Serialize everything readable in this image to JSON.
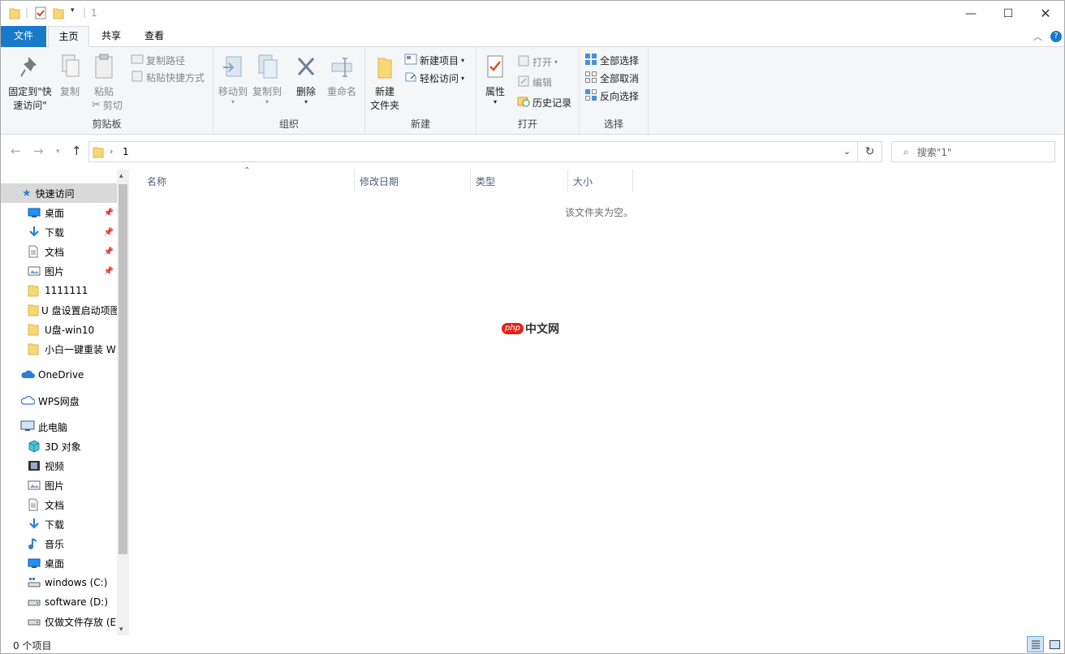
{
  "window": {
    "title": "1"
  },
  "tabs": {
    "file": "文件",
    "home": "主页",
    "share": "共享",
    "view": "查看"
  },
  "ribbon": {
    "clipboard": {
      "label": "剪贴板",
      "pin": "固定到\"快\n速访问\"",
      "copy": "复制",
      "paste": "粘贴",
      "copy_path": "复制路径",
      "paste_shortcut": "粘贴快捷方式",
      "cut": "剪切"
    },
    "organize": {
      "label": "组织",
      "move_to": "移动到",
      "copy_to": "复制到",
      "delete": "删除",
      "rename": "重命名"
    },
    "new": {
      "label": "新建",
      "new_folder": "新建\n文件夹",
      "new_item": "新建项目",
      "easy_access": "轻松访问"
    },
    "open": {
      "label": "打开",
      "properties": "属性",
      "open": "打开",
      "edit": "编辑",
      "history": "历史记录"
    },
    "select": {
      "label": "选择",
      "select_all": "全部选择",
      "select_none": "全部取消",
      "invert": "反向选择"
    }
  },
  "address": {
    "crumb": "1",
    "search_placeholder": "搜索\"1\""
  },
  "nav": {
    "quick_access": "快速访问",
    "quick_items": [
      {
        "label": "桌面",
        "icon": "desktop-icon",
        "pinned": true
      },
      {
        "label": "下载",
        "icon": "download-icon",
        "pinned": true
      },
      {
        "label": "文档",
        "icon": "document-icon",
        "pinned": true
      },
      {
        "label": "图片",
        "icon": "picture-icon",
        "pinned": true
      },
      {
        "label": "1111111",
        "icon": "folder-icon",
        "pinned": false
      },
      {
        "label": "U 盘设置启动项图",
        "icon": "folder-icon",
        "pinned": false
      },
      {
        "label": "U盘-win10",
        "icon": "folder-icon",
        "pinned": false
      },
      {
        "label": "小白一键重装 W",
        "icon": "folder-icon",
        "pinned": false
      }
    ],
    "onedrive": "OneDrive",
    "wps": "WPS网盘",
    "this_pc": "此电脑",
    "pc_items": [
      {
        "label": "3D 对象",
        "icon": "3d-objects-icon"
      },
      {
        "label": "视频",
        "icon": "video-icon"
      },
      {
        "label": "图片",
        "icon": "picture-icon"
      },
      {
        "label": "文档",
        "icon": "document-icon"
      },
      {
        "label": "下载",
        "icon": "download-icon"
      },
      {
        "label": "音乐",
        "icon": "music-icon"
      },
      {
        "label": "桌面",
        "icon": "desktop-icon"
      },
      {
        "label": "windows (C:)",
        "icon": "system-drive-icon"
      },
      {
        "label": "software (D:)",
        "icon": "drive-icon"
      },
      {
        "label": "仅做文件存放 (E",
        "icon": "drive-icon"
      }
    ]
  },
  "columns": {
    "name": "名称",
    "modified": "修改日期",
    "type": "类型",
    "size": "大小"
  },
  "content": {
    "empty_message": "该文件夹为空。",
    "watermark": "php中文网"
  },
  "status": {
    "count": "0 个项目"
  },
  "colors": {
    "accent": "#1979ca",
    "folder": "#f8d775"
  }
}
